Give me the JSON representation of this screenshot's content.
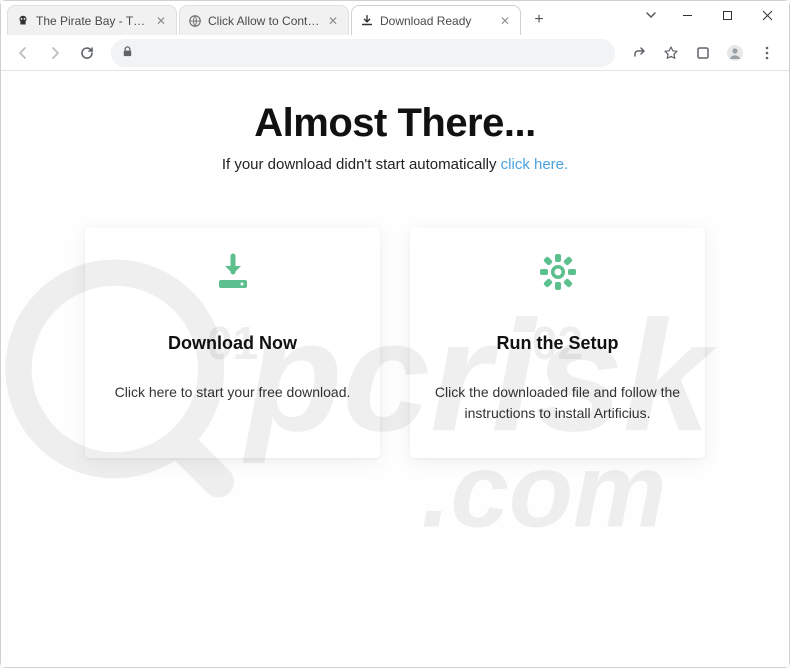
{
  "tabs": [
    {
      "title": "The Pirate Bay - The galaxy's mo",
      "active": false,
      "favicon": "skull"
    },
    {
      "title": "Click Allow to Continue",
      "active": false,
      "favicon": "globe"
    },
    {
      "title": "Download Ready",
      "active": true,
      "favicon": "download"
    }
  ],
  "page": {
    "headline": "Almost There...",
    "sub_prefix": "If your download didn't start automatically ",
    "sub_link": "click here.",
    "cards": [
      {
        "step": "01",
        "title": "Download Now",
        "text": "Click here to start your free download."
      },
      {
        "step": "02",
        "title": "Run the Setup",
        "text": "Click the downloaded file and follow the instructions to install Artificius."
      }
    ]
  },
  "watermark_text": "pcrisk.com"
}
